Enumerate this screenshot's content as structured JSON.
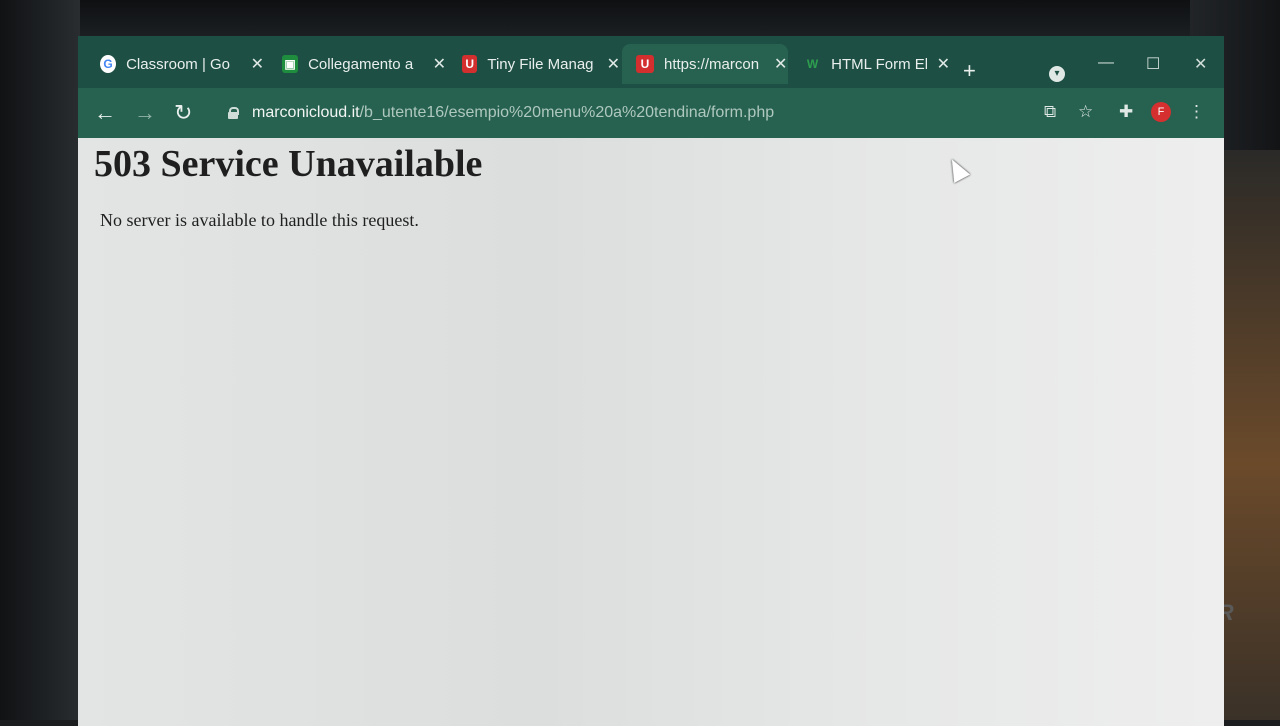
{
  "tabs": [
    {
      "title": "Classroom | Go",
      "favicon": "google-icon",
      "color": "#ffffff",
      "active": false
    },
    {
      "title": "Collegamento a",
      "favicon": "classroom-icon",
      "color": "#1e8e3e",
      "active": false
    },
    {
      "title": "Tiny File Manag",
      "favicon": "u-icon",
      "color": "#d32f2f",
      "active": false
    },
    {
      "title": "https://marcon",
      "favicon": "u-icon",
      "color": "#d32f2f",
      "active": true
    },
    {
      "title": "HTML Form Ele",
      "favicon": "w3-icon",
      "color": "#2e9e4f",
      "active": false
    }
  ],
  "toolbar": {
    "url_host": "marconicloud.it",
    "url_path": "/b_utente16/esempio%20menu%20a%20tendina/form.php"
  },
  "profile": {
    "initial": "F",
    "color": "#d62f2f"
  },
  "page": {
    "heading": "503 Service Unavailable",
    "message": "No server is available to handle this request."
  },
  "monitor": {
    "brand": "OSR"
  }
}
